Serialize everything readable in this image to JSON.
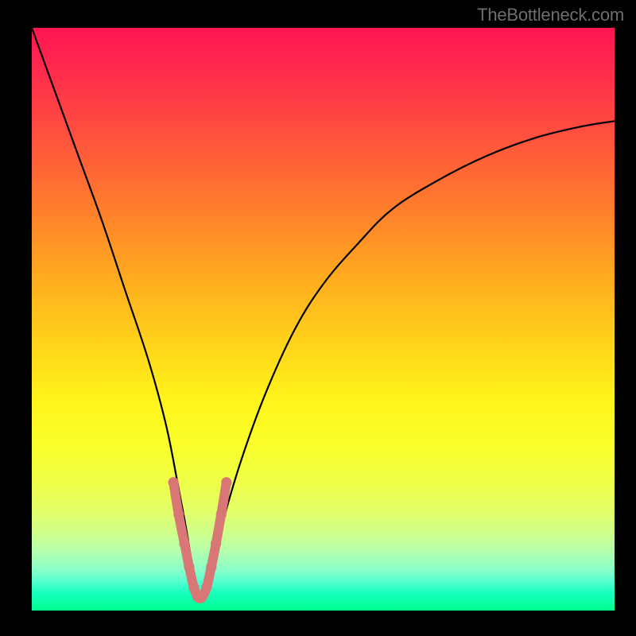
{
  "watermark": {
    "text": "TheBottleneck.com"
  },
  "chart_data": {
    "type": "line",
    "title": "",
    "xlabel": "",
    "ylabel": "",
    "xlim": [
      0,
      100
    ],
    "ylim": [
      0,
      100
    ],
    "grid": false,
    "legend": false,
    "series": [
      {
        "name": "bottleneck-curve",
        "color": "#000000",
        "x": [
          0,
          4,
          8,
          12,
          16,
          20,
          23,
          25,
          26.5,
          27.5,
          28.5,
          29.5,
          31,
          33,
          36,
          40,
          45,
          50,
          56,
          62,
          70,
          78,
          86,
          94,
          100
        ],
        "y": [
          100,
          89,
          78,
          67,
          55,
          43,
          32,
          22,
          14,
          8,
          3,
          3,
          8,
          16,
          26,
          37,
          48,
          56,
          63,
          69,
          74,
          78,
          81,
          83,
          84
        ]
      },
      {
        "name": "highlight-band",
        "color": "#d97676",
        "thickness": 12,
        "x": [
          24.3,
          25.2,
          26.2,
          27.0,
          27.8,
          28.5,
          29.2,
          30.0,
          30.8,
          31.6,
          32.5,
          33.4
        ],
        "y": [
          22.0,
          16.5,
          11.5,
          7.5,
          4.0,
          2.3,
          2.3,
          4.0,
          7.5,
          11.5,
          16.5,
          22.0
        ]
      }
    ],
    "background_gradient": {
      "type": "vertical",
      "stops": [
        {
          "pos": 0.0,
          "color": "#ff1452"
        },
        {
          "pos": 0.18,
          "color": "#ff4f3f"
        },
        {
          "pos": 0.42,
          "color": "#ffa81f"
        },
        {
          "pos": 0.64,
          "color": "#fff41a"
        },
        {
          "pos": 0.83,
          "color": "#e2ff6a"
        },
        {
          "pos": 0.93,
          "color": "#8affc8"
        },
        {
          "pos": 1.0,
          "color": "#00ff8f"
        }
      ]
    }
  }
}
